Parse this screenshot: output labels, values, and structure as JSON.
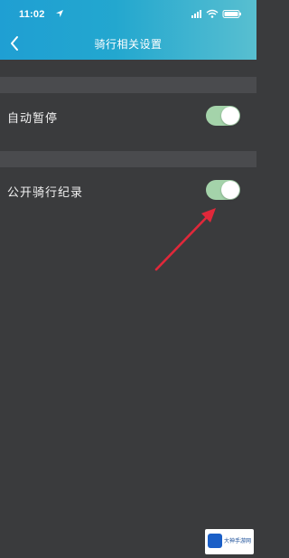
{
  "status_bar": {
    "time": "11:02",
    "icons": [
      "location-arrow-icon",
      "cellular-signal-icon",
      "wifi-icon",
      "battery-icon"
    ]
  },
  "header": {
    "back_icon": "chevron-left-icon",
    "title": "骑行相关设置"
  },
  "sections": [
    {
      "header": "",
      "items": [
        {
          "label": "自动暂停",
          "toggle_on": true
        }
      ]
    },
    {
      "header": "",
      "items": [
        {
          "label": "公开骑行纪录",
          "toggle_on": true
        }
      ]
    }
  ],
  "annotation": {
    "type": "red-arrow",
    "color": "#e0283a"
  },
  "watermark": {
    "text": "大神手游网"
  },
  "colors": {
    "header_start": "#1f9fd3",
    "header_end": "#58bfd0",
    "background": "#3a3b3d",
    "section_bg": "#4a4b4e",
    "toggle_on": "#a4d3aa"
  }
}
